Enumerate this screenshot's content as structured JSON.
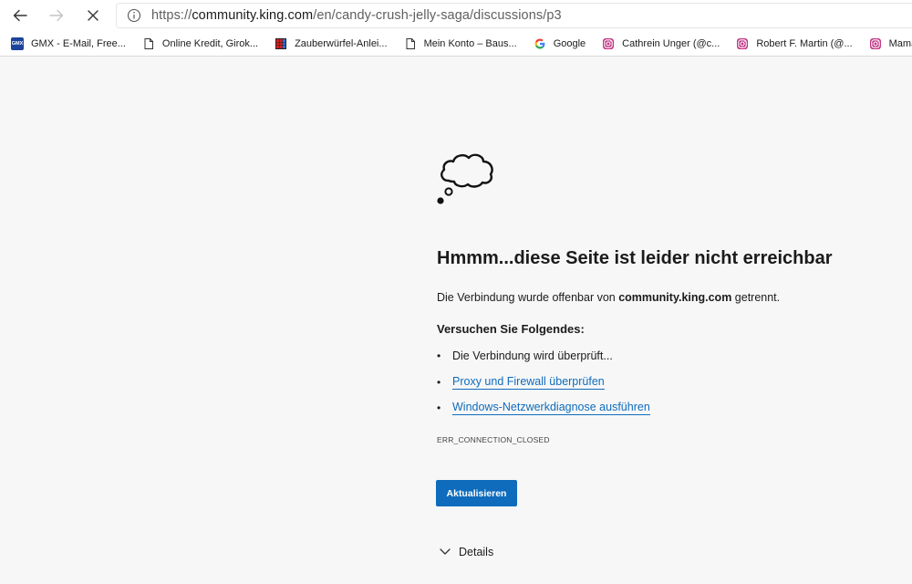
{
  "browser": {
    "url_prefix": "https://",
    "url_host": "community.king.com",
    "url_path": "/en/candy-crush-jelly-saga/discussions/p3"
  },
  "bookmarks": [
    {
      "label": "GMX - E-Mail, Free...",
      "icon": "gmx-icon",
      "icon_text": "GMX"
    },
    {
      "label": "Online Kredit, Girok...",
      "icon": "page-icon"
    },
    {
      "label": "Zauberwürfel-Anlei...",
      "icon": "rubiks-cube-icon"
    },
    {
      "label": "Mein Konto – Baus...",
      "icon": "page-icon"
    },
    {
      "label": "Google",
      "icon": "google-icon"
    },
    {
      "label": "Cathrein Unger (@c...",
      "icon": "instagram-icon"
    },
    {
      "label": "Robert F. Martin (@...",
      "icon": "instagram-icon"
    },
    {
      "label": "Mamacat (@kein",
      "icon": "instagram-icon"
    }
  ],
  "error": {
    "title": "Hmmm...diese Seite ist leider nicht erreichbar",
    "desc_before": "Die Verbindung wurde offenbar von ",
    "desc_host": "community.king.com",
    "desc_after": " getrennt.",
    "try_heading": "Versuchen Sie Folgendes:",
    "suggestions": [
      {
        "text": "Die Verbindung wird überprüft...",
        "is_link": false
      },
      {
        "text": "Proxy und Firewall überprüfen",
        "is_link": true
      },
      {
        "text": "Windows-Netzwerkdiagnose ausführen",
        "is_link": true
      }
    ],
    "error_code": "ERR_CONNECTION_CLOSED",
    "refresh_label": "Aktualisieren",
    "details_label": "Details"
  },
  "colors": {
    "accent": "#0f6cbd",
    "page_bg": "#f7f7f7",
    "instagram": "#c13584",
    "gmx": "#1c449b"
  }
}
